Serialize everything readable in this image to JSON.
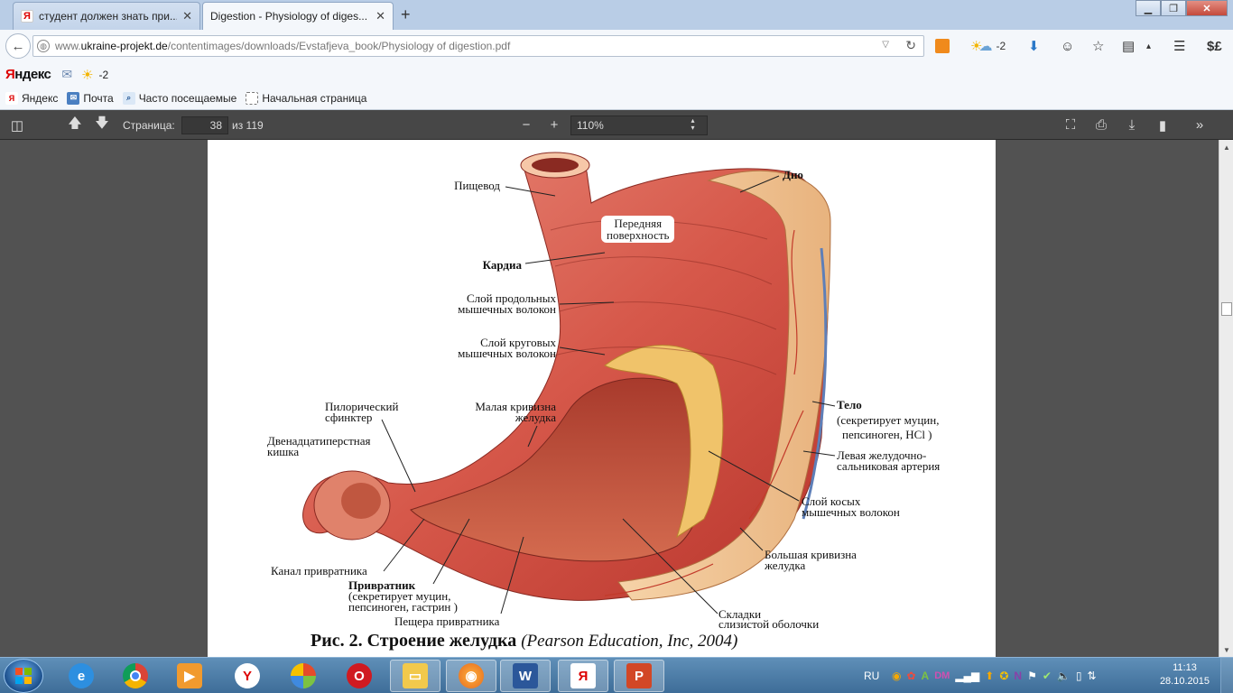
{
  "browser": {
    "tabs": [
      {
        "title": "студент должен знать при...",
        "favicon": "yandex-icon",
        "active": false
      },
      {
        "title": "Digestion - Physiology of diges...",
        "favicon": "pdf-icon",
        "active": true
      }
    ],
    "url_prefix": "www.",
    "url_host": "ukraine-projekt.de",
    "url_path": "/contentimages/downloads/Evstafjeva_book/Physiology of digestion.pdf",
    "weather_temp": "-2",
    "currency_icon": "$£"
  },
  "yandex_bar": {
    "logo_first": "Я",
    "logo_rest": "ндекс",
    "temp": "-2"
  },
  "bookmarks": [
    {
      "label": "Яндекс",
      "icon": "yandex-icon"
    },
    {
      "label": "Почта",
      "icon": "mail-icon"
    },
    {
      "label": "Часто посещаемые",
      "icon": "search-doc-icon"
    },
    {
      "label": "Начальная страница",
      "icon": "page-icon"
    }
  ],
  "pdf_toolbar": {
    "page_label": "Страница:",
    "page_value": "38",
    "page_total": "из 119",
    "zoom": "110%",
    "zoom_minus": "−",
    "zoom_plus": "+"
  },
  "figure": {
    "labels": {
      "pishchevod": "Пищевод",
      "dno": "Дно",
      "perednyaya1": "Передняя",
      "perednyaya2": "поверхность",
      "kardia": "Кардиа",
      "prodol1": "Слой продольных",
      "prodol2": "мышечных волокон",
      "krug1": "Слой круговых",
      "krug2": "мышечных волокон",
      "piloric1": "Пилорический",
      "piloric2": "сфинктер",
      "malaya1": "Малая кривизна",
      "malaya2": "желудка",
      "dvenad1": "Двенадцатиперстная",
      "dvenad2": "кишка",
      "telo": "Тело",
      "telo2": "(секретирует муцин,",
      "telo3": "пепсиноген, HCl )",
      "levaya1": "Левая желудочно-",
      "levaya2": "сальниковая артерия",
      "kos1": "Слой косых",
      "kos2": "мышечных волокон",
      "bolsh1": "Большая кривизна",
      "bolsh2": "желудка",
      "kanal": "Канал привратника",
      "privr": "Привратник",
      "privr2": "(секретирует муцин,",
      "privr3": "пепсиноген, гастрин )",
      "peshch": "Пещера привратника",
      "sklad1": "Складки",
      "sklad2": "слизистой оболочки"
    },
    "caption_main": "Рис. 2. Строение желудка",
    "caption_source": "(Pearson Education, Inc, 2004)"
  },
  "taskbar": {
    "lang": "RU",
    "time": "11:13",
    "date": "28.10.2015"
  }
}
